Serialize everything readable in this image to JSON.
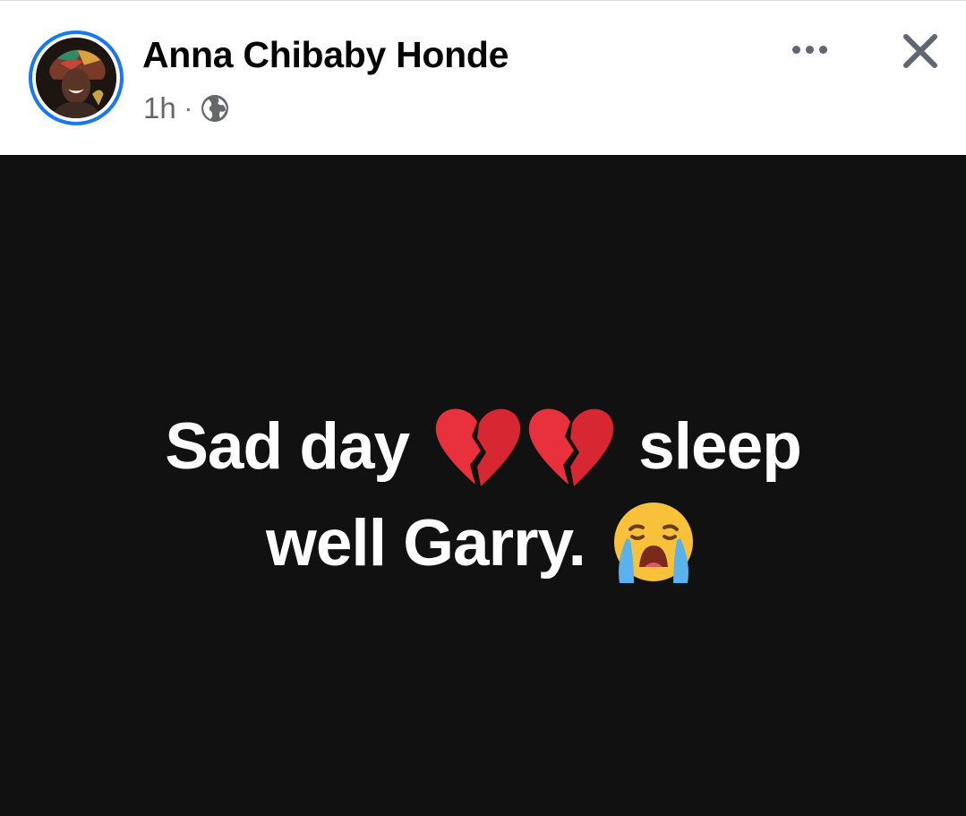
{
  "post": {
    "author": "Anna Chibaby Honde",
    "timestamp": "1h",
    "separator": "·",
    "audience_icon": "globe-icon",
    "text": {
      "line1_start": "Sad day",
      "line1_end": "sleep",
      "line2": "well Garry.",
      "emojis": [
        "broken-heart",
        "broken-heart",
        "loudly-crying-face"
      ]
    },
    "background_color": "#111111",
    "text_color": "#ffffff"
  },
  "header": {
    "more_icon": "more-options-icon",
    "close_icon": "close-icon"
  },
  "colors": {
    "accent": "#1877f2",
    "name": "#050505",
    "meta": "#65676b"
  }
}
